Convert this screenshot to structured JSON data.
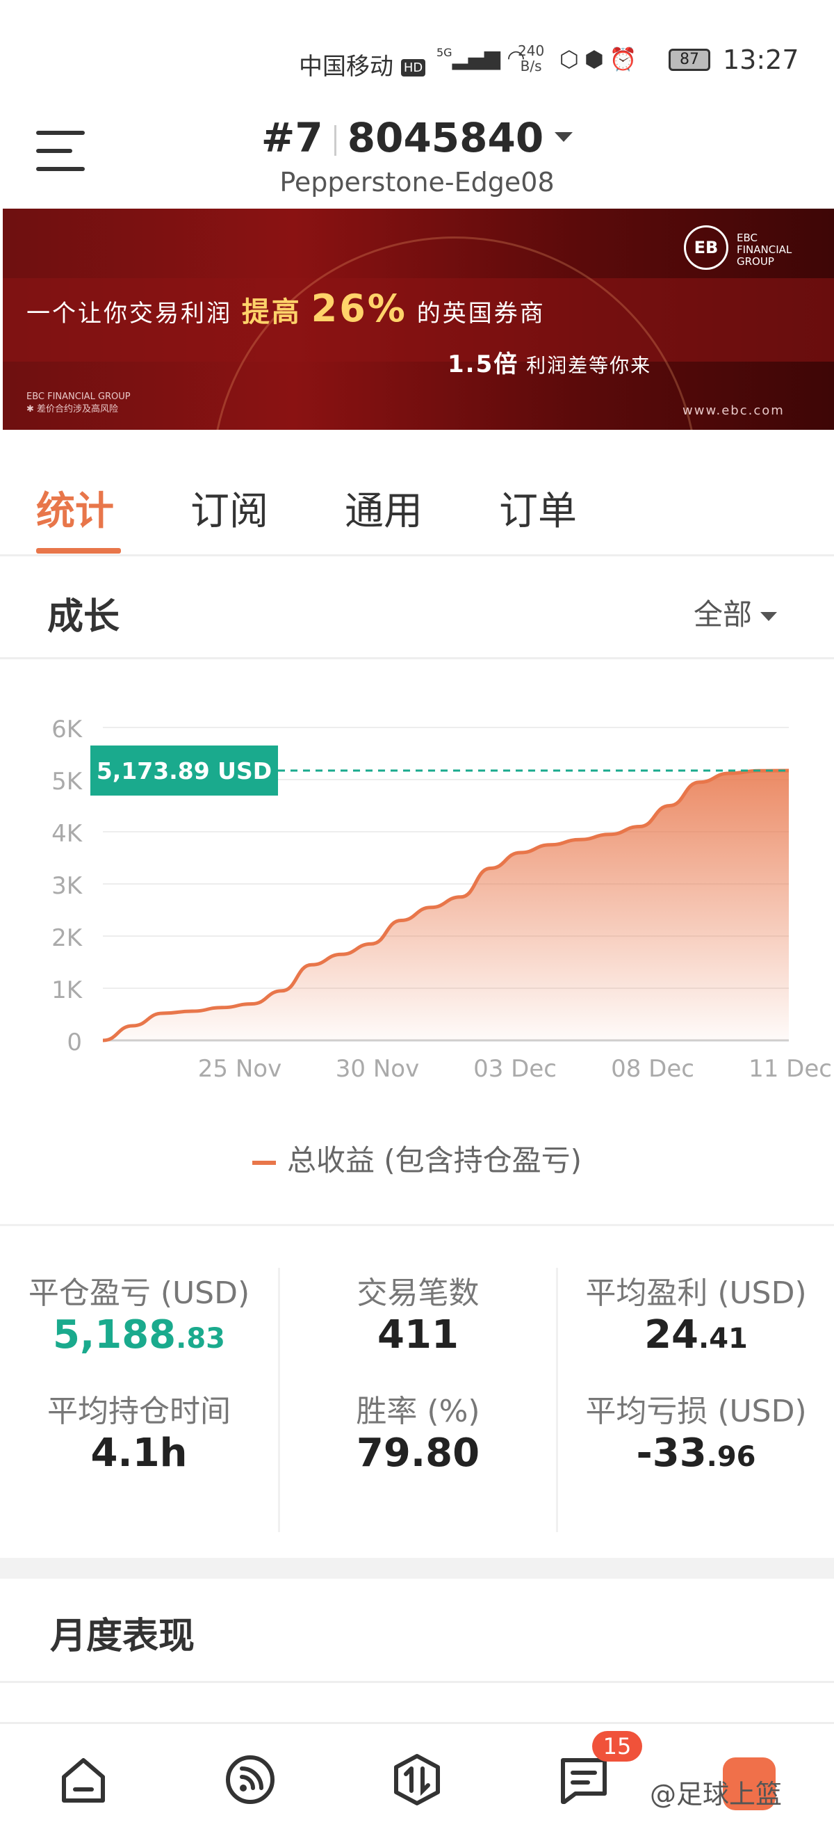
{
  "status_bar": {
    "carrier": "中国移动",
    "hd": "HD",
    "network": "5G",
    "speed_value": "240",
    "speed_unit": "B/s",
    "battery": "87",
    "time": "13:27"
  },
  "header": {
    "rank": "#7",
    "account_number": "8045840",
    "server": "Pepperstone-Edge08"
  },
  "banner": {
    "line1_prefix": "一个让你交易利润",
    "line1_highlight": "提高",
    "line1_big": "26%",
    "line1_suffix": "的英国券商",
    "line2_big": "1.5倍",
    "line2_suffix": "利润差等你来",
    "logo": "EB",
    "logo_text_1": "EBC",
    "logo_text_2": "FINANCIAL",
    "logo_text_3": "GROUP",
    "footer_1": "EBC FINANCIAL GROUP",
    "footer_2": "✱ 差价合约涉及高风险",
    "url": "www.ebc.com"
  },
  "tabs": [
    {
      "label": "统计",
      "active": true
    },
    {
      "label": "订阅",
      "active": false
    },
    {
      "label": "通用",
      "active": false
    },
    {
      "label": "订单",
      "active": false
    }
  ],
  "growth": {
    "title": "成长",
    "range": "全部"
  },
  "chart_data": {
    "type": "area",
    "ylim": [
      0,
      6000
    ],
    "yticks": [
      "0",
      "1K",
      "2K",
      "3K",
      "4K",
      "5K",
      "6K"
    ],
    "xticks": [
      "25 Nov",
      "30 Nov",
      "03 Dec",
      "08 Dec",
      "11 Dec"
    ],
    "current_label": "5,173.89 USD",
    "current_value": 5173.89,
    "series": [
      {
        "name": "总收益 (包含持仓盈亏)",
        "values": [
          0,
          280,
          520,
          560,
          630,
          700,
          950,
          1450,
          1650,
          1850,
          2300,
          2550,
          2750,
          3300,
          3600,
          3750,
          3850,
          3950,
          4100,
          4500,
          4950,
          5120,
          5170,
          5173.89
        ]
      }
    ],
    "line_color": "#e8764a",
    "label_color": "#1aaa8d"
  },
  "stats": {
    "closed_pnl_label": "平仓盈亏 (USD)",
    "closed_pnl_int": "5,188",
    "closed_pnl_dec": ".83",
    "trades_label": "交易笔数",
    "trades": "411",
    "avg_profit_label": "平均盈利 (USD)",
    "avg_profit_int": "24",
    "avg_profit_dec": ".41",
    "avg_hold_label": "平均持仓时间",
    "avg_hold": "4.1h",
    "win_rate_label": "胜率 (%)",
    "win_rate": "79.80",
    "avg_loss_label": "平均亏损 (USD)",
    "avg_loss_int": "-33",
    "avg_loss_dec": ".96"
  },
  "monthly": {
    "title": "月度表现"
  },
  "bottom_nav": {
    "badge": "15",
    "watermark": "@足球上篮"
  }
}
